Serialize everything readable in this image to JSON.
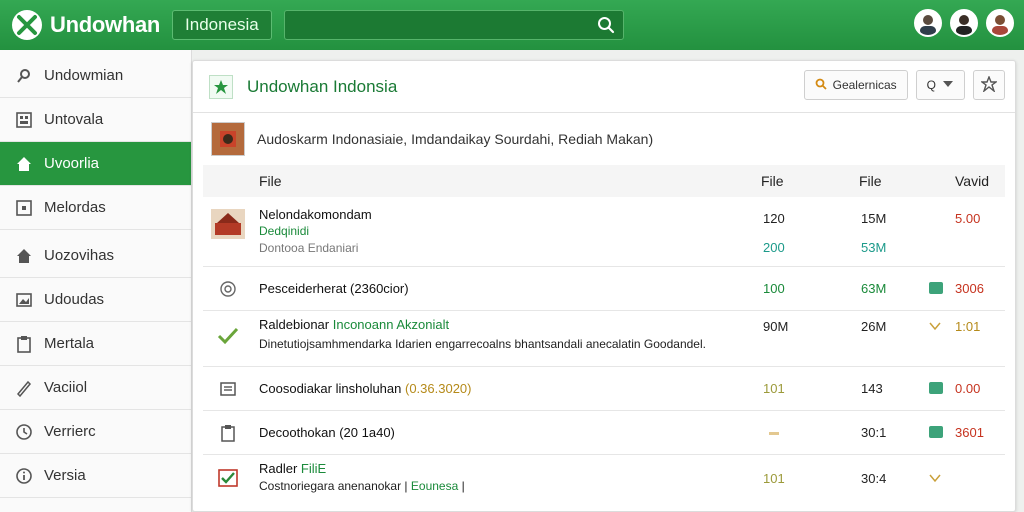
{
  "header": {
    "app_name": "Undowhan",
    "region_pill": "Indonesia",
    "search_value": "",
    "search_placeholder": ""
  },
  "sidebar": {
    "items": [
      {
        "label": "Undowmian",
        "icon": "pin-icon"
      },
      {
        "label": "Untovala",
        "icon": "grid-icon"
      },
      {
        "label": "Uvoorlia",
        "icon": "home-icon",
        "active": true
      },
      {
        "label": "Melordas",
        "icon": "square-icon"
      },
      {
        "label": "Uozovihas",
        "icon": "house-icon"
      },
      {
        "label": "Udoudas",
        "icon": "image-icon"
      },
      {
        "label": "Mertala",
        "icon": "clipboard-icon"
      },
      {
        "label": "Vaciiol",
        "icon": "pencil-icon"
      },
      {
        "label": "Verrierc",
        "icon": "clock-icon"
      },
      {
        "label": "Versia",
        "icon": "info-icon"
      }
    ]
  },
  "card": {
    "title": "Undowhan Indonsia",
    "search_button_label": "Gealernicas",
    "filter_button_label": "Q",
    "context_text": "Audoskarm Indonasiaie, Imdandaikay Sourdahi, Rediah Makan)",
    "table": {
      "headers": [
        "File",
        "File",
        "File",
        "Vavid"
      ],
      "rows": [
        {
          "title": "Nelondakomondam",
          "subtitle": "Dedqinidi",
          "detail": "Dontooa Endaniari",
          "v1": "120",
          "v1b": "200",
          "v2": "15M",
          "v2b": "53M",
          "v3": "5.00"
        },
        {
          "title": "Pesceiderherat (2360cior)",
          "v1": "100",
          "v2": "63M",
          "v3": "3006"
        },
        {
          "title": "Raldebionar",
          "title_accent": "Inconoann Akzonialt",
          "detail": "Dinetutiojsamhmendarka Idarien engarrecoalns bhantsandali anecalatin Goodandel.",
          "v1": "90M",
          "v2": "26M",
          "v3": "1:01"
        },
        {
          "title": "Coosodiakar linsholuhan",
          "title_accent": "(0.36.3020)",
          "v1": "101",
          "v2": "143",
          "v3": "0.00"
        },
        {
          "title": "Decoothokan (20 1a40)",
          "v2": "30:1",
          "v3": "3601"
        },
        {
          "title": "Radler",
          "title_accent": "FiliE",
          "detail": "Costnoriegara anenanokar |",
          "detail_accent": "Eounesa",
          "detail_tail": "|",
          "v1": "101",
          "v2": "30:4"
        }
      ]
    }
  },
  "colors": {
    "brand_green": "#27963f",
    "accent_red": "#c6331f",
    "accent_teal": "#1c9a8a"
  }
}
